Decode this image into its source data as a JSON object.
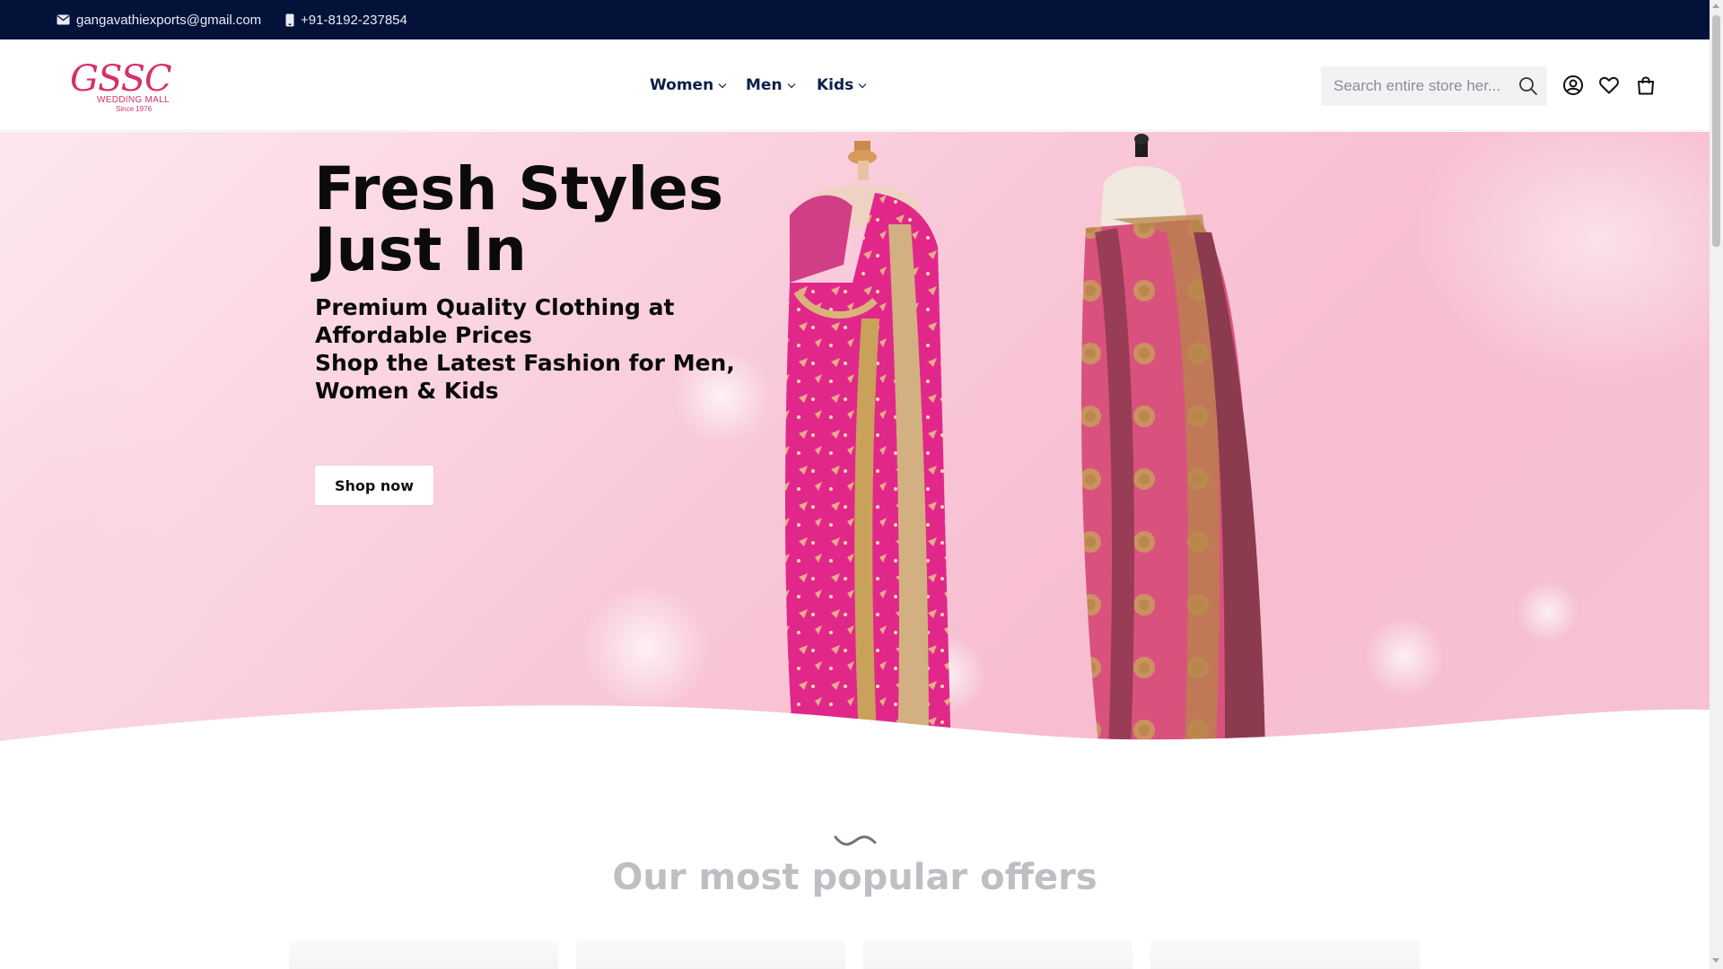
{
  "topbar": {
    "email": "gangavathiexports@gmail.com",
    "phone": "+91-8192-237854",
    "email_icon": "mail-icon",
    "phone_icon": "mobile-phone-icon",
    "background": "#04123a"
  },
  "header": {
    "logo": {
      "mark": "GSSC",
      "sub": "WEDDING MALL",
      "since": "Since 1976",
      "color": "#d62f6a"
    },
    "nav": [
      {
        "label": "Women",
        "icon": "chevron-down-icon"
      },
      {
        "label": "Men",
        "icon": "chevron-down-icon"
      },
      {
        "label": "Kids",
        "icon": "chevron-down-icon"
      }
    ],
    "search": {
      "placeholder": "Search entire store her...",
      "icon": "search-icon"
    },
    "icons": [
      "account-icon",
      "wishlist-icon",
      "cart-icon"
    ]
  },
  "hero": {
    "title": "Fresh Styles Just In",
    "subtitle_line1": "Premium Quality Clothing at Affordable Prices",
    "subtitle_line2": "Shop the Latest Fashion for Men, Women & Kids",
    "cta": "Shop now",
    "colors": {
      "background": "#f7bdd0",
      "saree_primary": "#e1288a",
      "saree_secondary": "#d9527e",
      "zari": "#c9a15a"
    }
  },
  "offers": {
    "title": "Our most popular offers",
    "decor_icon": "tilde-divider-icon"
  }
}
